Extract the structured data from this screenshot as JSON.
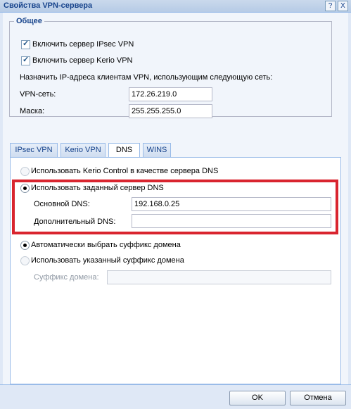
{
  "window": {
    "title": "Свойства VPN-сервера",
    "help_button": "?",
    "close_button": "X"
  },
  "general": {
    "legend": "Общее",
    "enable_ipsec": {
      "label": "Включить сервер IPsec VPN",
      "checked": true
    },
    "enable_kerio": {
      "label": "Включить сервер Kerio VPN",
      "checked": true
    },
    "assign_text": "Назначить IP-адреса клиентам VPN, использующим следующую сеть:",
    "network_label": "VPN-сеть:",
    "network_value": "172.26.219.0",
    "mask_label": "Маска:",
    "mask_value": "255.255.255.0"
  },
  "tabs": [
    {
      "label": "IPsec VPN",
      "active": false
    },
    {
      "label": "Kerio VPN",
      "active": false
    },
    {
      "label": "DNS",
      "active": true
    },
    {
      "label": "WINS",
      "active": false
    }
  ],
  "dns": {
    "use_kerio_label": "Использовать Kerio Control в качестве сервера DNS",
    "use_custom_label": "Использовать заданный сервер DNS",
    "primary_label": "Основной DNS:",
    "primary_value": "192.168.0.25",
    "secondary_label": "Дополнительный DNS:",
    "secondary_value": "",
    "auto_suffix_label": "Автоматически выбрать суффикс домена",
    "custom_suffix_label": "Использовать указанный суффикс домена",
    "suffix_label": "Суффикс домена:",
    "suffix_value": ""
  },
  "buttons": {
    "ok": "OK",
    "cancel": "Отмена"
  },
  "colors": {
    "highlight": "#d9252f",
    "title_text": "#15428b"
  }
}
